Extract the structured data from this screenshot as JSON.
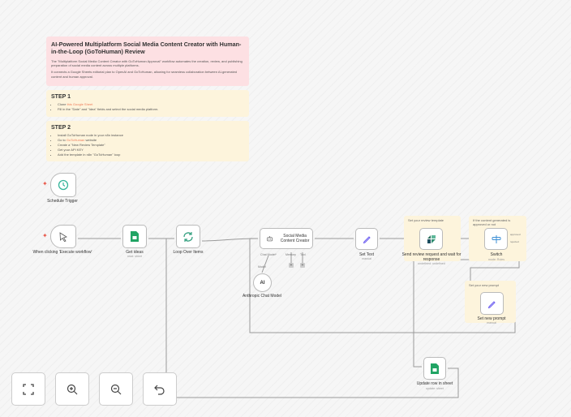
{
  "notes": {
    "intro": {
      "title": "AI-Powered Multiplatform Social Media Content Creator with Human-in-the-Loop (GoToHuman) Review",
      "p1": "The \"Multiplatform Social Media Content Creator with GoToHuman Approval\" workflow automates the creation, review, and publishing preparation of social media content across multiple platforms.",
      "p2": "It connects a Google Sheets editorial plan to OpenAI and GoToHuman, allowing for seamless collaboration between AI-generated content and human approval."
    },
    "step1": {
      "title": "STEP 1",
      "items": [
        {
          "pre": "Clone ",
          "link": "this Google Sheet",
          "post": ""
        },
        {
          "pre": "Fill in the \"Date\" and \"Idea\" fields and select the social media platform.",
          "link": "",
          "post": ""
        }
      ]
    },
    "step2": {
      "title": "STEP 2",
      "items": [
        "Install GoToHuman node in your n8n instance",
        {
          "pre": "Go to ",
          "link": "GoToHuman",
          "post": " website"
        },
        "Create a \"New Review Template\"",
        "Get your API KEY",
        "Add the template in n8n \"GoToHuman\" loop"
      ]
    },
    "review_template": "Set your review template",
    "approved_or_not": "If the content generated is approved or not",
    "new_prompt": "Set your new prompt"
  },
  "nodes": {
    "schedule": {
      "label": "Schedule Trigger"
    },
    "manual": {
      "label": "When clicking 'Execute workflow'"
    },
    "get_ideas": {
      "label": "Get ideas",
      "sub": "read: sheet"
    },
    "loop": {
      "label": "Loop Over Items"
    },
    "agent": {
      "label": "Social Media Content Creator",
      "ports": [
        "Chat Model*",
        "Memory",
        "Tool"
      ]
    },
    "anthropic": {
      "label": "Anthropic Chat Model",
      "port": "Model"
    },
    "set_text": {
      "label": "Set Text",
      "sub": "manual"
    },
    "review": {
      "label": "Send review request and wait for response",
      "sub": "undefined: undefined"
    },
    "switch": {
      "label": "Switch",
      "sub": "mode: Rules",
      "outputs": [
        "approved",
        "rejected"
      ]
    },
    "set_prompt": {
      "label": "Set new prompt",
      "sub": "manual"
    },
    "update": {
      "label": "Update row in sheet",
      "sub": "update: sheet"
    }
  },
  "colors": {
    "sheets": "#21a464",
    "loop": "#35a080",
    "pencil": "#6b5cf0",
    "switch": "#3c8fd6",
    "trigger": "#e8584a"
  },
  "controls": [
    "fit-view",
    "zoom-in",
    "zoom-out",
    "undo"
  ]
}
